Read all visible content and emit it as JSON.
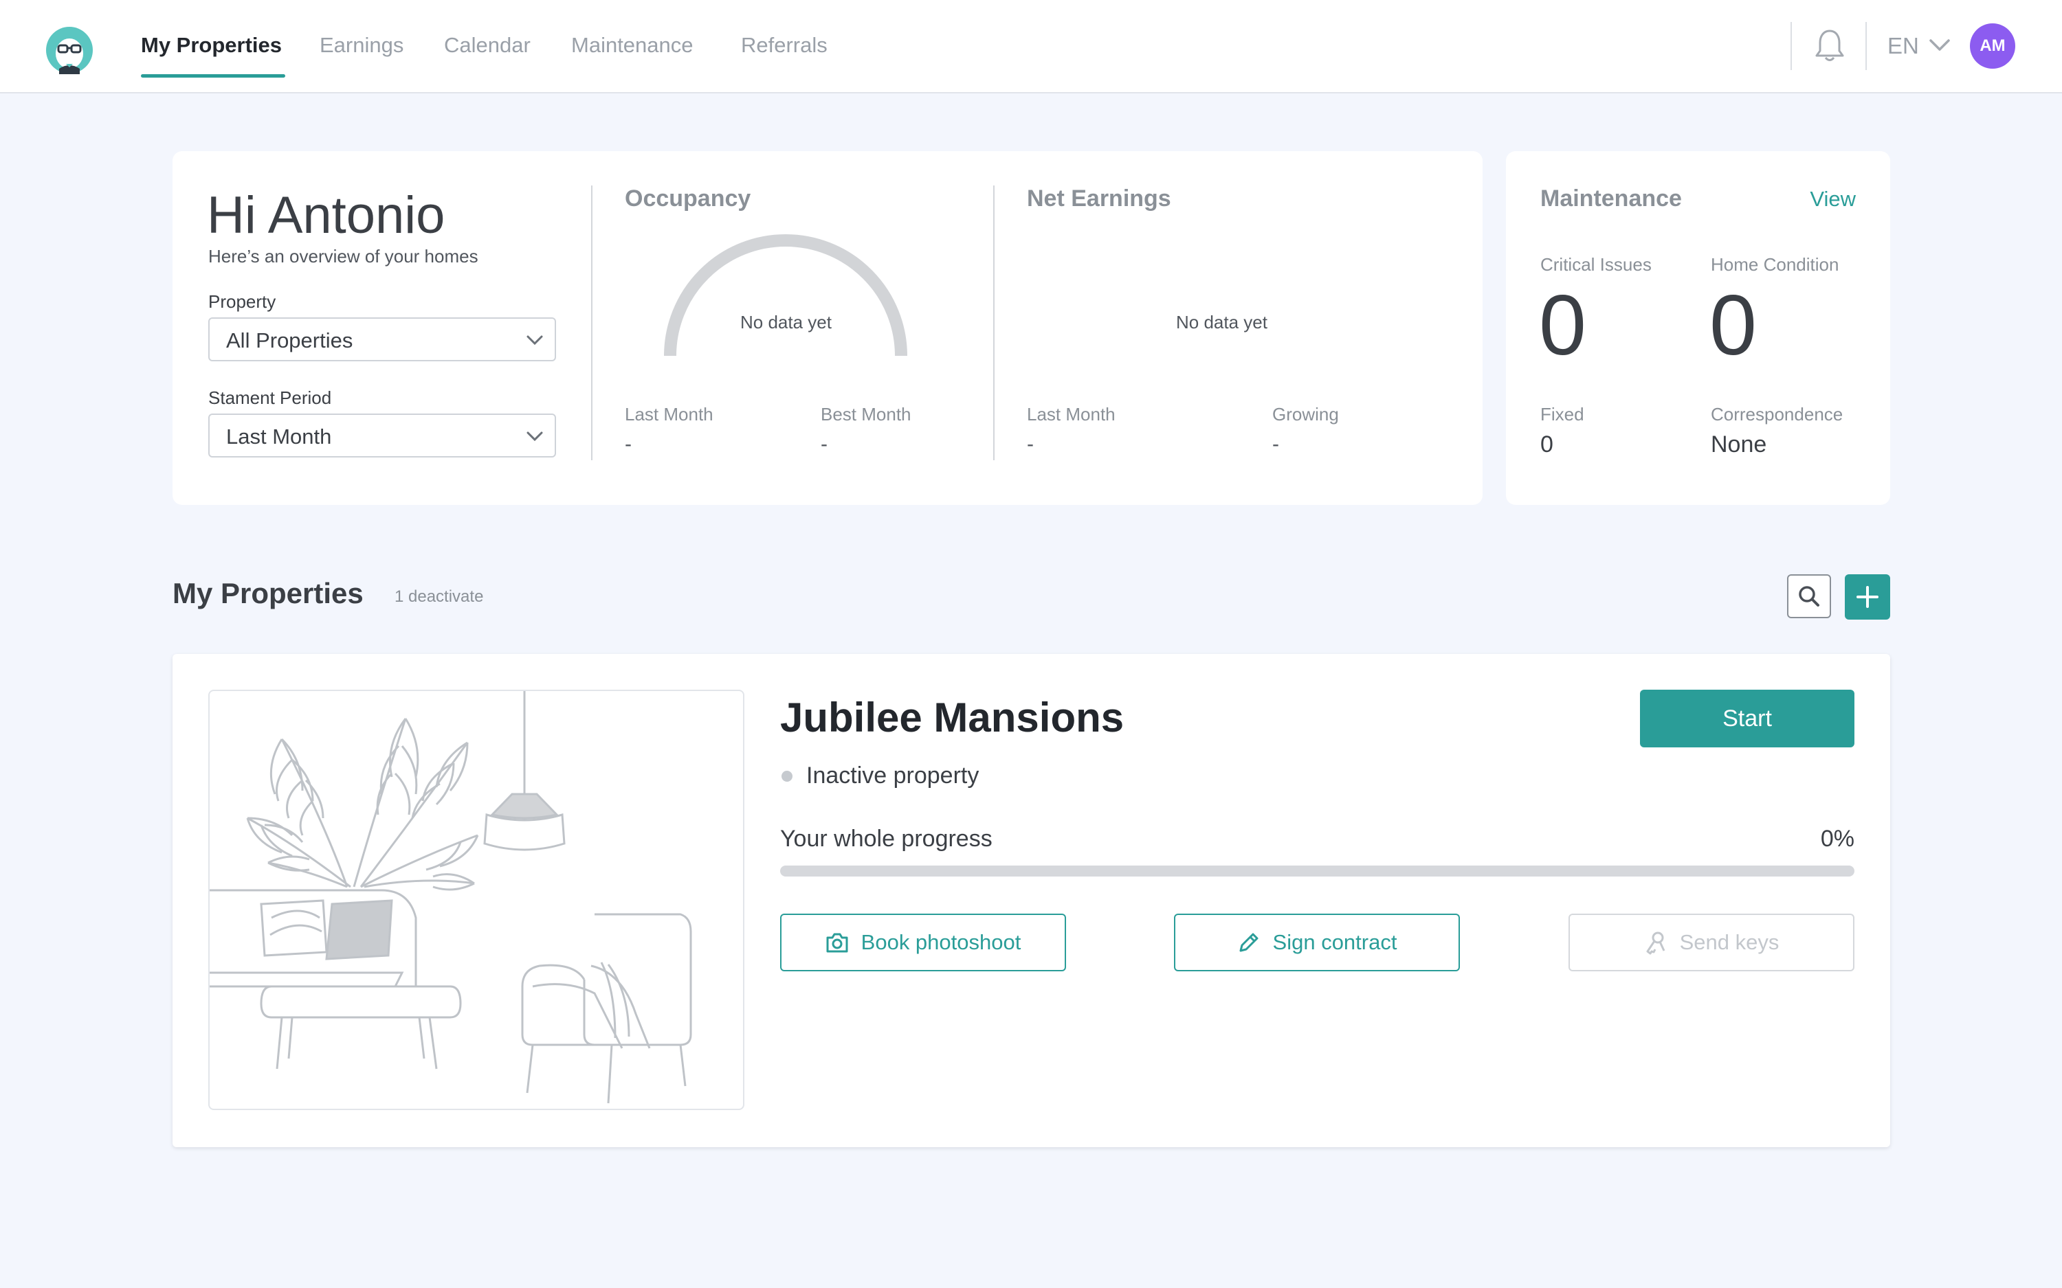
{
  "nav": {
    "items": [
      {
        "label": "My Properties",
        "active": true
      },
      {
        "label": "Earnings",
        "active": false
      },
      {
        "label": "Calendar",
        "active": false
      },
      {
        "label": "Maintenance",
        "active": false
      },
      {
        "label": "Referrals",
        "active": false
      }
    ],
    "language": "EN",
    "avatar_initials": "AM"
  },
  "overview": {
    "greeting": "Hi Antonio",
    "subtitle": "Here’s an overview of your homes",
    "property_label": "Property",
    "property_value": "All Properties",
    "period_label": "Stament Period",
    "period_value": "Last Month",
    "occupancy": {
      "title": "Occupancy",
      "empty_text": "No data yet",
      "last_month_label": "Last Month",
      "last_month_value": "-",
      "best_month_label": "Best Month",
      "best_month_value": "-"
    },
    "net_earnings": {
      "title": "Net Earnings",
      "empty_text": "No data yet",
      "last_month_label": "Last Month",
      "last_month_value": "-",
      "growing_label": "Growing",
      "growing_value": "-"
    }
  },
  "maintenance": {
    "title": "Maintenance",
    "view_label": "View",
    "critical_label": "Critical Issues",
    "critical_value": "0",
    "condition_label": "Home Condition",
    "condition_value": "0",
    "fixed_label": "Fixed",
    "fixed_value": "0",
    "correspondence_label": "Correspondence",
    "correspondence_value": "None"
  },
  "properties": {
    "title": "My Properties",
    "subtitle": "1 deactivate",
    "items": [
      {
        "name": "Jubilee Mansions",
        "status": "Inactive property",
        "start_label": "Start",
        "progress_label": "Your whole progress",
        "progress_text": "0%",
        "progress_fraction": 0,
        "actions": {
          "photoshoot": "Book photoshoot",
          "contract": "Sign contract",
          "keys": "Send keys"
        }
      }
    ]
  },
  "colors": {
    "accent": "#2a9d98",
    "avatar": "#8c5cf0",
    "background": "#f3f6fd"
  }
}
